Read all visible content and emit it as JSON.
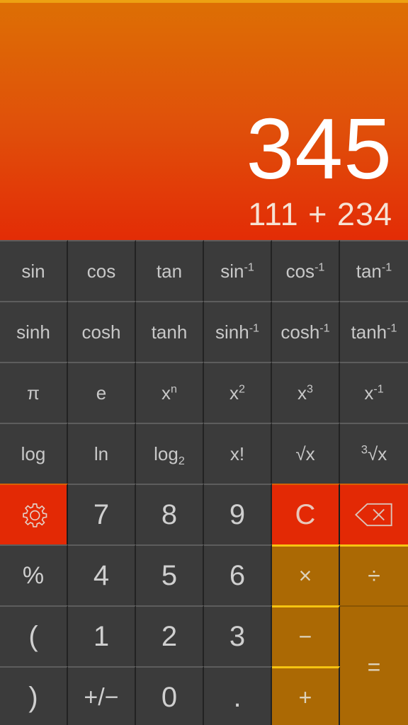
{
  "app": {
    "name": "Scientific Calculator",
    "theme": {
      "display_top": "#dd6f04",
      "display_bottom": "#e32c06",
      "accent_strip": "#eda112",
      "key_bg": "#3b3b3b",
      "key_text": "#c8c8c8",
      "red_key": "#e32905",
      "operator_key": "#ab6904",
      "operator_border": "#f5c411"
    }
  },
  "display": {
    "result": "345",
    "expression": "111 + 234"
  },
  "keypad": {
    "rows": [
      {
        "name": "trig-row",
        "keys": [
          {
            "name": "sin-button",
            "label": "sin",
            "kind": "func"
          },
          {
            "name": "cos-button",
            "label": "cos",
            "kind": "func"
          },
          {
            "name": "tan-button",
            "label": "tan",
            "kind": "func"
          },
          {
            "name": "asin-button",
            "label": "sin-1",
            "kind": "func"
          },
          {
            "name": "acos-button",
            "label": "cos-1",
            "kind": "func"
          },
          {
            "name": "atan-button",
            "label": "tan-1",
            "kind": "func"
          }
        ]
      },
      {
        "name": "hyperbolic-row",
        "keys": [
          {
            "name": "sinh-button",
            "label": "sinh",
            "kind": "func"
          },
          {
            "name": "cosh-button",
            "label": "cosh",
            "kind": "func"
          },
          {
            "name": "tanh-button",
            "label": "tanh",
            "kind": "func"
          },
          {
            "name": "asinh-button",
            "label": "sinh-1",
            "kind": "func"
          },
          {
            "name": "acosh-button",
            "label": "cosh-1",
            "kind": "func"
          },
          {
            "name": "atanh-button",
            "label": "tanh-1",
            "kind": "func"
          }
        ]
      },
      {
        "name": "constants-power-row",
        "keys": [
          {
            "name": "pi-button",
            "label": "π",
            "kind": "func"
          },
          {
            "name": "euler-button",
            "label": "e",
            "kind": "func"
          },
          {
            "name": "x-pow-n-button",
            "label": "xn",
            "kind": "func"
          },
          {
            "name": "x-squared-button",
            "label": "x2",
            "kind": "func"
          },
          {
            "name": "x-cubed-button",
            "label": "x3",
            "kind": "func"
          },
          {
            "name": "reciprocal-button",
            "label": "x-1",
            "kind": "func"
          }
        ]
      },
      {
        "name": "log-root-row",
        "keys": [
          {
            "name": "log-button",
            "label": "log",
            "kind": "func"
          },
          {
            "name": "ln-button",
            "label": "ln",
            "kind": "func"
          },
          {
            "name": "log2-button",
            "label": "log2",
            "kind": "func"
          },
          {
            "name": "factorial-button",
            "label": "x!",
            "kind": "func"
          },
          {
            "name": "sqrt-button",
            "label": "√x",
            "kind": "func"
          },
          {
            "name": "cbrt-button",
            "label": "3√x",
            "kind": "func"
          }
        ]
      },
      {
        "name": "keypad-row-789",
        "keys": [
          {
            "name": "settings-button",
            "label": "gear-icon",
            "kind": "red-icon"
          },
          {
            "name": "digit-7-button",
            "label": "7",
            "kind": "num"
          },
          {
            "name": "digit-8-button",
            "label": "8",
            "kind": "num"
          },
          {
            "name": "digit-9-button",
            "label": "9",
            "kind": "num"
          },
          {
            "name": "clear-button",
            "label": "C",
            "kind": "red"
          },
          {
            "name": "backspace-button",
            "label": "backspace-icon",
            "kind": "red-icon"
          }
        ]
      },
      {
        "name": "keypad-row-456",
        "keys": [
          {
            "name": "percent-button",
            "label": "%",
            "kind": "pct"
          },
          {
            "name": "digit-4-button",
            "label": "4",
            "kind": "num"
          },
          {
            "name": "digit-5-button",
            "label": "5",
            "kind": "num"
          },
          {
            "name": "digit-6-button",
            "label": "6",
            "kind": "num"
          },
          {
            "name": "multiply-button",
            "label": "×",
            "kind": "op"
          },
          {
            "name": "divide-button",
            "label": "÷",
            "kind": "op"
          }
        ]
      },
      {
        "name": "keypad-row-123",
        "keys": [
          {
            "name": "open-paren-button",
            "label": "(",
            "kind": "paren"
          },
          {
            "name": "digit-1-button",
            "label": "1",
            "kind": "num"
          },
          {
            "name": "digit-2-button",
            "label": "2",
            "kind": "num"
          },
          {
            "name": "digit-3-button",
            "label": "3",
            "kind": "num"
          },
          {
            "name": "subtract-button",
            "label": "−",
            "kind": "op"
          },
          {
            "name": "equals-button",
            "label": "=",
            "kind": "equals"
          }
        ]
      },
      {
        "name": "keypad-row-0",
        "keys": [
          {
            "name": "close-paren-button",
            "label": ")",
            "kind": "paren"
          },
          {
            "name": "plus-minus-button",
            "label": "+/−",
            "kind": "sign"
          },
          {
            "name": "digit-0-button",
            "label": "0",
            "kind": "num"
          },
          {
            "name": "decimal-point-button",
            "label": ".",
            "kind": "dot"
          },
          {
            "name": "add-button",
            "label": "+",
            "kind": "op"
          }
        ]
      }
    ]
  }
}
